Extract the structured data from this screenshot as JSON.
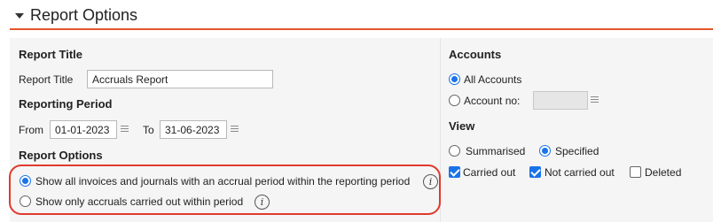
{
  "header": {
    "title": "Report Options"
  },
  "report_title": {
    "heading": "Report Title",
    "label": "Report Title",
    "value": "Accruals Report"
  },
  "reporting_period": {
    "heading": "Reporting Period",
    "from_label": "From",
    "from_value": "01-01-2023",
    "to_label": "To",
    "to_value": "31-06-2023"
  },
  "report_options": {
    "heading": "Report Options",
    "options": [
      {
        "label": "Show all invoices and journals with an accrual period within the reporting period",
        "selected": true
      },
      {
        "label": "Show only accruals carried out within period",
        "selected": false
      }
    ],
    "info_glyph": "i"
  },
  "accounts": {
    "heading": "Accounts",
    "all_label": "All Accounts",
    "all_selected": true,
    "account_no_label": "Account no:",
    "account_no_value": "",
    "account_no_selected": false
  },
  "view": {
    "heading": "View",
    "summarised_label": "Summarised",
    "summarised_selected": false,
    "specified_label": "Specified",
    "specified_selected": true,
    "carried_out_label": "Carried out",
    "carried_out_checked": true,
    "not_carried_out_label": "Not carried out",
    "not_carried_out_checked": true,
    "deleted_label": "Deleted",
    "deleted_checked": false
  },
  "colors": {
    "accent_line": "#e2562b",
    "highlight": "#e03a2e",
    "control_blue": "#1a73e8"
  },
  "icons": [
    "caret-down-icon",
    "calendar-icon",
    "info-icon"
  ]
}
